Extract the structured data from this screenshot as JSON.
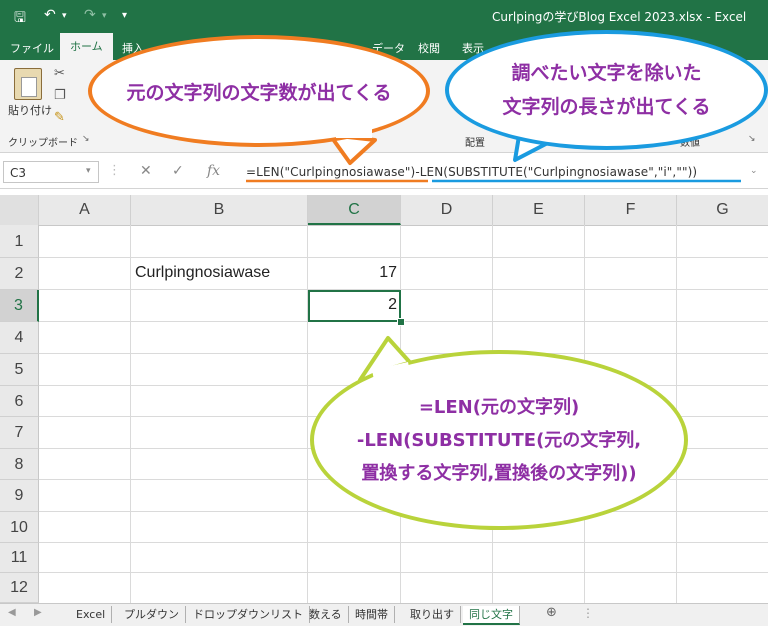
{
  "window": {
    "title": "Curlpingの学びBlog  Excel  2023.xlsx  -  Excel"
  },
  "ribbon_tabs": [
    "ファイル",
    "ホーム",
    "挿入",
    "データ",
    "校閲",
    "表示"
  ],
  "ribbon": {
    "paste_label": "貼り付け",
    "clipboard_group": "クリップボード",
    "alignment_group": "配置",
    "number_group": "数値"
  },
  "formula_bar": {
    "namebox": "C3",
    "fx": "fx",
    "formula": "=LEN(\"Curlpingnosiawase\")-LEN(SUBSTITUTE(\"Curlpingnosiawase\",\"i\",\"\"))"
  },
  "columns": [
    "A",
    "B",
    "C",
    "D",
    "E",
    "F",
    "G"
  ],
  "rows": [
    "1",
    "2",
    "3",
    "4",
    "5",
    "6",
    "7",
    "8",
    "9",
    "10",
    "11",
    "12"
  ],
  "cells": {
    "B2": "Curlpingnosiawase",
    "C2": "17",
    "C3": "2"
  },
  "sheet_tabs": [
    "Excel",
    "プルダウン",
    "ドロップダウンリスト",
    "数える",
    "時間帯",
    "取り出す",
    "同じ文字"
  ],
  "active_sheet": "同じ文字",
  "callouts": {
    "orange": "元の文字列の文字数が出てくる",
    "blue_line1": "調べたい文字を除いた",
    "blue_line2": "文字列の長さが出てくる",
    "green_line1": "=LEN(元の文字列)",
    "green_line2": "-LEN(SUBSTITUTE(元の文字列,",
    "green_line3": "置換する文字列,置換後の文字列))"
  },
  "colors": {
    "excel_green": "#217346",
    "orange": "#f07c21",
    "blue": "#1a9be0",
    "lime": "#b9d33b",
    "purple_text": "#8e2fa4"
  },
  "icons": [
    "save-icon",
    "undo-icon",
    "redo-icon",
    "qat-dropdown-icon",
    "cut-icon",
    "copy-icon",
    "format-painter-icon",
    "cancel-icon",
    "enter-icon",
    "add-sheet-icon"
  ]
}
